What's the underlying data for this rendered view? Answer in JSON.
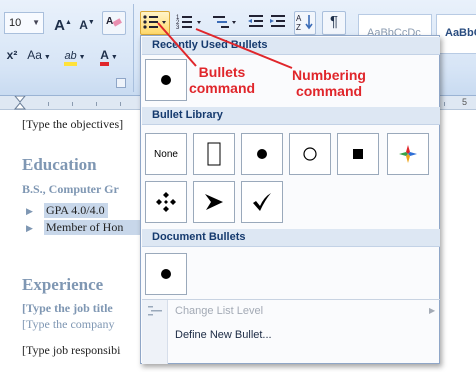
{
  "ribbon": {
    "font_size": "10",
    "grow_font": "A",
    "shrink_font": "A",
    "style_previews": [
      "AaBbCcDc",
      "AaBbC"
    ],
    "superscript": "x²",
    "change_case": "Aa",
    "highlight": "ab",
    "font_color": "A"
  },
  "ruler": {
    "number": "5"
  },
  "document": {
    "objectives": "[Type the objectives]",
    "education_heading": "Education",
    "degree": "B.S., Computer Gr",
    "bullet_1": "GPA 4.0/4.0",
    "bullet_2": "Member of Hon",
    "experience_heading": "Experience",
    "job_title": "[Type the job title",
    "company": "[Type the company",
    "responsibilities": "[Type job responsibi"
  },
  "gallery": {
    "recent_header": "Recently Used Bullets",
    "library_header": "Bullet Library",
    "document_header": "Document Bullets",
    "none_label": "None",
    "change_list_level": "Change List Level",
    "define_new_bullet": "Define New Bullet..."
  },
  "annotations": {
    "bullets_line1": "Bullets",
    "bullets_line2": "command",
    "numbering_line1": "Numbering",
    "numbering_line2": "command",
    "color": "#e0262b"
  }
}
